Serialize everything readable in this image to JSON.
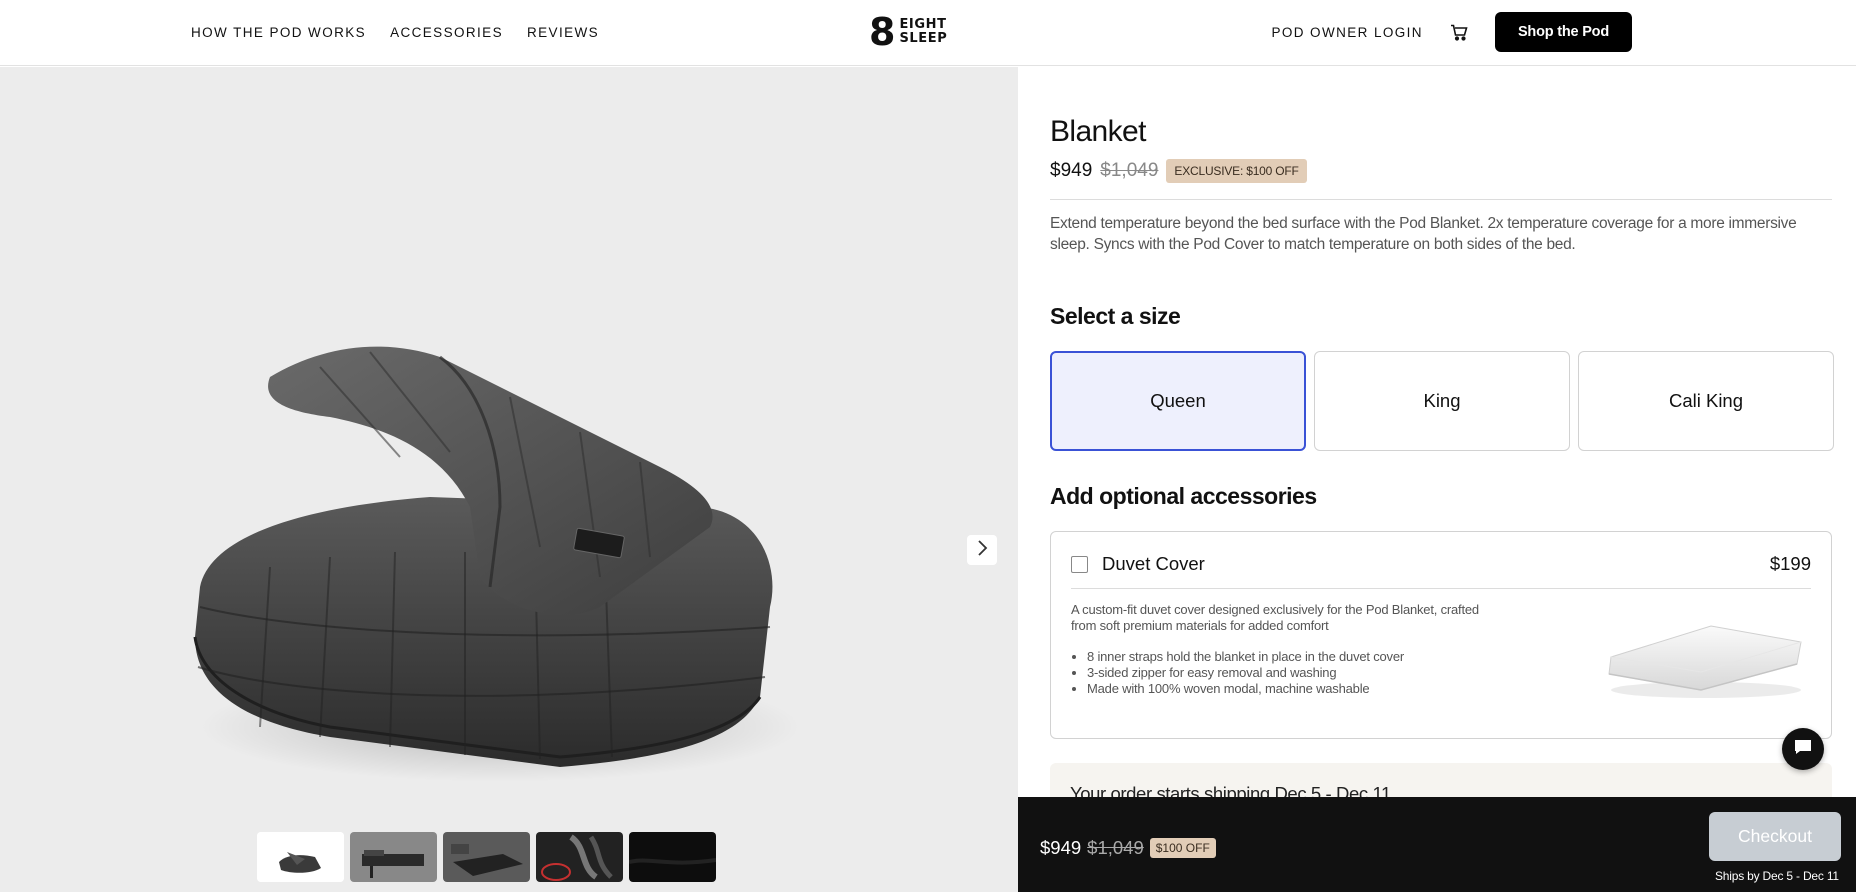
{
  "header": {
    "nav": [
      "HOW THE POD WORKS",
      "ACCESSORIES",
      "REVIEWS"
    ],
    "logo_mark": "8",
    "logo_line1": "EIGHT",
    "logo_line2": "SLEEP",
    "owner_login": "POD OWNER LOGIN",
    "cart_icon": "cart-icon",
    "shop_button": "Shop the Pod"
  },
  "gallery": {
    "thumbnail_count": 5,
    "next_icon": "chevron-right-icon"
  },
  "product": {
    "title": "Blanket",
    "price": "$949",
    "price_old": "$1,049",
    "badge": "EXCLUSIVE: $100 OFF",
    "description": "Extend temperature beyond the bed surface with the Pod Blanket. 2x temperature coverage for a more immersive sleep. Syncs with the Pod Cover to match temperature on both sides of the bed."
  },
  "sizes": {
    "title": "Select a size",
    "options": [
      "Queen",
      "King",
      "Cali King"
    ],
    "selected": "Queen"
  },
  "accessories": {
    "title": "Add optional accessories",
    "item": {
      "name": "Duvet Cover",
      "price": "$199",
      "checked": false,
      "description": "A custom-fit duvet cover designed exclusively for the Pod Blanket, crafted from soft premium materials for added comfort",
      "features": [
        "8 inner straps hold the blanket in place in the duvet cover",
        "3-sided zipper for easy removal and washing",
        "Made with 100% woven modal, machine washable"
      ]
    }
  },
  "shipping": {
    "text": "Your order starts shipping Dec 5 - Dec 11"
  },
  "bottombar": {
    "price": "$949",
    "price_old": "$1,049",
    "badge": "$100 OFF",
    "checkout": "Checkout",
    "ships_by": "Ships by Dec 5 - Dec 11"
  },
  "chat_icon": "chat-icon",
  "colors": {
    "accent": "#3a52d6",
    "badge_bg": "#e2cdb7",
    "bottombar_bg": "#111111",
    "checkout_disabled": "#c7cdd3"
  }
}
